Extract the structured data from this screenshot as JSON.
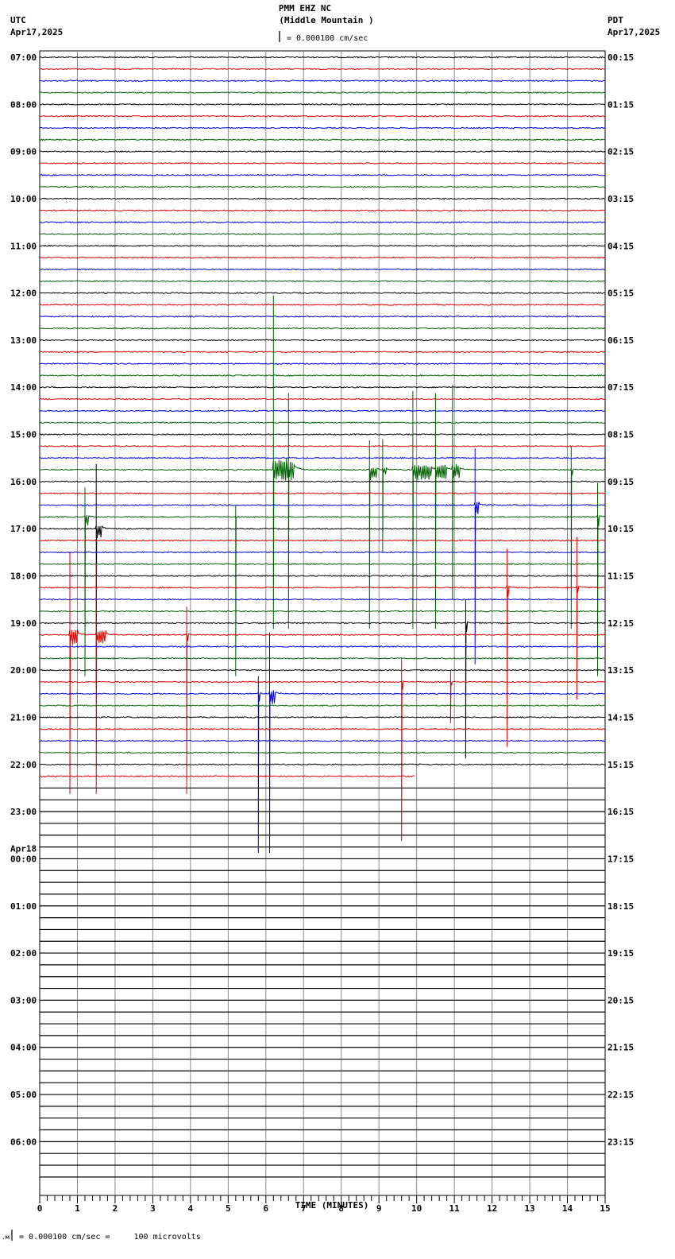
{
  "header": {
    "title": "PMM EHZ NC",
    "subtitle": "(Middle Mountain )",
    "scale": "= 0.000100 cm/sec",
    "left_tz": "UTC",
    "left_date": "Apr17,2025",
    "right_tz": "PDT",
    "right_date": "Apr17,2025"
  },
  "footer": {
    "scale_note": "= 0.000100 cm/sec =     100 microvolts"
  },
  "chart_data": {
    "type": "line",
    "title": "PMM EHZ NC (Middle Mountain )",
    "xlabel": "TIME (MINUTES)",
    "xlim": [
      0,
      15
    ],
    "x_ticks": [
      "0",
      "1",
      "2",
      "3",
      "4",
      "5",
      "6",
      "7",
      "8",
      "9",
      "10",
      "11",
      "12",
      "13",
      "14",
      "15"
    ],
    "traces_per_hour": 4,
    "trace_count": 96,
    "data_end": {
      "trace": 61,
      "minute": 9.95
    },
    "trace_colors": [
      "#000000",
      "#e00000",
      "#0000e0",
      "#006000"
    ],
    "left_labels": [
      {
        "trace": 0,
        "text": "07:00"
      },
      {
        "trace": 4,
        "text": "08:00"
      },
      {
        "trace": 8,
        "text": "09:00"
      },
      {
        "trace": 12,
        "text": "10:00"
      },
      {
        "trace": 16,
        "text": "11:00"
      },
      {
        "trace": 20,
        "text": "12:00"
      },
      {
        "trace": 24,
        "text": "13:00"
      },
      {
        "trace": 28,
        "text": "14:00"
      },
      {
        "trace": 32,
        "text": "15:00"
      },
      {
        "trace": 36,
        "text": "16:00"
      },
      {
        "trace": 40,
        "text": "17:00"
      },
      {
        "trace": 44,
        "text": "18:00"
      },
      {
        "trace": 48,
        "text": "19:00"
      },
      {
        "trace": 52,
        "text": "20:00"
      },
      {
        "trace": 56,
        "text": "21:00"
      },
      {
        "trace": 60,
        "text": "22:00"
      },
      {
        "trace": 64,
        "text": "23:00"
      },
      {
        "trace": 68,
        "text": "00:00",
        "date": "Apr18"
      },
      {
        "trace": 72,
        "text": "01:00"
      },
      {
        "trace": 76,
        "text": "02:00"
      },
      {
        "trace": 80,
        "text": "03:00"
      },
      {
        "trace": 84,
        "text": "04:00"
      },
      {
        "trace": 88,
        "text": "05:00"
      },
      {
        "trace": 92,
        "text": "06:00"
      }
    ],
    "right_labels": [
      "00:15",
      "01:15",
      "02:15",
      "03:15",
      "04:15",
      "05:15",
      "06:15",
      "07:15",
      "08:15",
      "09:15",
      "10:15",
      "11:15",
      "12:15",
      "13:15",
      "14:15",
      "15:15",
      "16:15",
      "17:15",
      "18:15",
      "19:15",
      "20:15",
      "21:15",
      "22:15",
      "23:15"
    ],
    "events": [
      {
        "trace": 35,
        "minute": 6.2,
        "up": 14.8,
        "down": 13.5,
        "burst": 0.5
      },
      {
        "trace": 35,
        "minute": 6.6,
        "up": 6.5,
        "down": 13.5,
        "burst": 0.15
      },
      {
        "trace": 35,
        "minute": 8.75,
        "up": 2.5,
        "down": 13.5,
        "burst": 0.2
      },
      {
        "trace": 35,
        "minute": 9.1,
        "up": 2.6,
        "down": 7,
        "burst": 0.1
      },
      {
        "trace": 35,
        "minute": 9.9,
        "up": 6.7,
        "down": 13.5,
        "burst": 0.5
      },
      {
        "trace": 35,
        "minute": 10.5,
        "up": 6.5,
        "down": 13.5,
        "burst": 0.3
      },
      {
        "trace": 35,
        "minute": 10.95,
        "up": 7.2,
        "down": 11,
        "burst": 0.2
      },
      {
        "trace": 35,
        "minute": 14.1,
        "up": 2.0,
        "down": 13.5,
        "burst": 0.05
      },
      {
        "trace": 38,
        "minute": 11.55,
        "up": 4.8,
        "down": 13.5,
        "burst": 0.1
      },
      {
        "trace": 40,
        "minute": 1.5,
        "up": 5.5,
        "down": 13.5,
        "burst": 0.15
      },
      {
        "trace": 39,
        "minute": 1.2,
        "up": 2.5,
        "down": 13.5,
        "burst": 0.1
      },
      {
        "trace": 39,
        "minute": 5.2,
        "up": 1.0,
        "down": 13.5,
        "burst": 0.02
      },
      {
        "trace": 39,
        "minute": 14.8,
        "up": 2.9,
        "down": 13.5,
        "burst": 0.05
      },
      {
        "trace": 45,
        "minute": 12.4,
        "up": 3.3,
        "down": 13.5,
        "burst": 0.05
      },
      {
        "trace": 45,
        "minute": 14.25,
        "up": 4.3,
        "down": 9.5,
        "burst": 0.05
      },
      {
        "trace": 48,
        "minute": 11.3,
        "up": 2.0,
        "down": 11.5,
        "burst": 0.05
      },
      {
        "trace": 49,
        "minute": 0.8,
        "up": 7,
        "down": 13.5,
        "burst": 0.2
      },
      {
        "trace": 49,
        "minute": 1.5,
        "up": 6,
        "down": 13.5,
        "burst": 0.25
      },
      {
        "trace": 49,
        "minute": 3.9,
        "up": 2.4,
        "down": 13.5,
        "burst": 0.03
      },
      {
        "trace": 53,
        "minute": 9.6,
        "up": 2.0,
        "down": 13.5,
        "burst": 0.03
      },
      {
        "trace": 53,
        "minute": 10.9,
        "up": 1.0,
        "down": 3.5,
        "burst": 0.03
      },
      {
        "trace": 54,
        "minute": 6.1,
        "up": 5.2,
        "down": 13.5,
        "burst": 0.15
      },
      {
        "trace": 54,
        "minute": 5.8,
        "up": 1.5,
        "down": 13.5,
        "burst": 0.05
      }
    ]
  }
}
